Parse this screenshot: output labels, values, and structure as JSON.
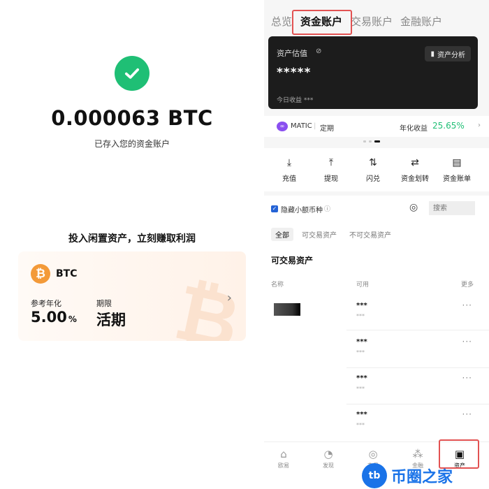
{
  "left": {
    "amount": "0.000063 BTC",
    "deposited_text": "已存入您的资金账户",
    "invest_title": "投入闲置资产，立刻赚取利润",
    "card": {
      "coin": "BTC",
      "logo_glyph": "₿",
      "watermark_glyph": "₿",
      "ref_apr_label": "参考年化",
      "ref_apr_value": "5.00",
      "ref_apr_unit": "%",
      "term_label": "期限",
      "term_value": "活期"
    }
  },
  "right": {
    "tabs": [
      "总览",
      "资金账户",
      "交易账户",
      "金融账户"
    ],
    "active_tab": "资金账户",
    "asset_card": {
      "estimate_label": "资产估值",
      "hidden_value": "*****",
      "today_label": "今日收益",
      "today_value": "***",
      "analysis_button": "资产分析"
    },
    "promo": {
      "coin": "MATIC",
      "term": "定期",
      "yield_label": "年化收益",
      "yield_value": "25.65%"
    },
    "actions": [
      {
        "label": "充值",
        "icon": "deposit-icon"
      },
      {
        "label": "提现",
        "icon": "withdraw-icon"
      },
      {
        "label": "闪兑",
        "icon": "swap-icon"
      },
      {
        "label": "资金划转",
        "icon": "transfer-icon"
      },
      {
        "label": "资金账单",
        "icon": "bill-icon"
      }
    ],
    "filter": {
      "hide_small_label": "隐藏小额币种",
      "search_placeholder": "搜索"
    },
    "segments": [
      "全部",
      "可交易资产",
      "不可交易资产"
    ],
    "section_title": "可交易资产",
    "columns": {
      "name": "名称",
      "available": "可用",
      "more": "更多"
    },
    "rows": [
      {
        "value": "***",
        "sub": "***",
        "more": "···"
      },
      {
        "value": "***",
        "sub": "***",
        "more": "···"
      },
      {
        "value": "***",
        "sub": "***",
        "more": "···"
      },
      {
        "value": "***",
        "sub": "***",
        "more": "···"
      }
    ],
    "bottom_nav": [
      {
        "label": "欧易",
        "icon": "home-icon"
      },
      {
        "label": "发现",
        "icon": "discover-icon"
      },
      {
        "label": "交易",
        "icon": "trade-icon"
      },
      {
        "label": "金融",
        "icon": "finance-icon"
      },
      {
        "label": "资产",
        "icon": "wallet-icon"
      }
    ],
    "active_nav": "资产"
  },
  "watermark": {
    "badge": "tb",
    "text": "币圈之家"
  },
  "colors": {
    "success": "#1fbf75",
    "btc": "#f39a39",
    "highlight": "#e25252",
    "watermark": "#1a73e8"
  }
}
